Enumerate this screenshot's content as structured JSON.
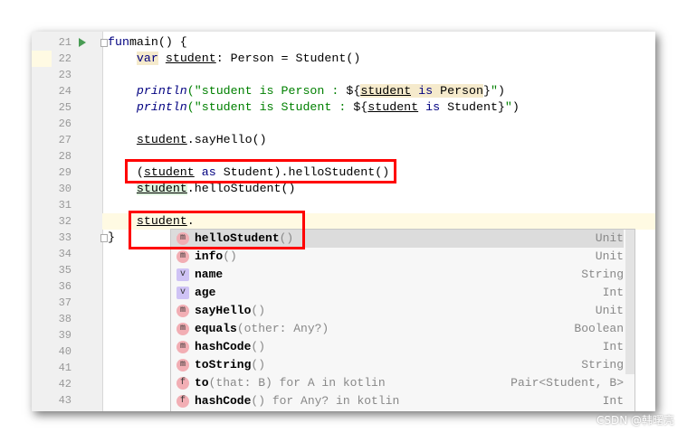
{
  "editor": {
    "lines": [
      {
        "n": "21",
        "run": true,
        "fold": true,
        "seg": [
          [
            "kw",
            "fun"
          ],
          [
            "",
            "main() {"
          ]
        ]
      },
      {
        "n": "22",
        "seg": [
          [
            "",
            "    "
          ],
          [
            "kw hl",
            "var"
          ],
          [
            "",
            " "
          ],
          [
            "ul",
            "student"
          ],
          [
            "",
            ": Person = Student()"
          ]
        ]
      },
      {
        "n": "23",
        "seg": []
      },
      {
        "n": "24",
        "seg": [
          [
            "",
            "    "
          ],
          [
            "fn",
            "println"
          ],
          [
            "str",
            "(\"student is Person : "
          ],
          [
            "",
            "${"
          ],
          [
            "ul hl",
            "student"
          ],
          [
            "hl",
            " "
          ],
          [
            "kw hl",
            "is"
          ],
          [
            "hl",
            " Person"
          ],
          [
            "",
            "}"
          ],
          [
            "str",
            "\""
          ],
          [
            "",
            ")"
          ]
        ]
      },
      {
        "n": "25",
        "seg": [
          [
            "",
            "    "
          ],
          [
            "fn",
            "println"
          ],
          [
            "str",
            "(\"student is Student : "
          ],
          [
            "",
            "${"
          ],
          [
            "ul",
            "student"
          ],
          [
            "",
            " "
          ],
          [
            "kw",
            "is"
          ],
          [
            "",
            " Student}"
          ],
          [
            "str",
            "\""
          ],
          [
            "",
            ")"
          ]
        ]
      },
      {
        "n": "26",
        "seg": []
      },
      {
        "n": "27",
        "seg": [
          [
            "",
            "    "
          ],
          [
            "ul",
            "student"
          ],
          [
            "",
            ".sayHello()"
          ]
        ]
      },
      {
        "n": "28",
        "seg": []
      },
      {
        "n": "29",
        "seg": [
          [
            "",
            "    ("
          ],
          [
            "ul",
            "student"
          ],
          [
            "",
            " "
          ],
          [
            "kw",
            "as"
          ],
          [
            "",
            " Student).helloStudent()"
          ]
        ]
      },
      {
        "n": "30",
        "seg": [
          [
            "",
            "    "
          ],
          [
            "ul gr",
            "student"
          ],
          [
            "",
            ".helloStudent()"
          ]
        ]
      },
      {
        "n": "31",
        "seg": []
      },
      {
        "n": "32",
        "cur": true,
        "seg": [
          [
            "",
            "    "
          ],
          [
            "ul",
            "student"
          ],
          [
            "",
            "."
          ]
        ]
      },
      {
        "n": "33",
        "fold": true,
        "seg": [
          [
            "",
            "}"
          ]
        ]
      },
      {
        "n": "34",
        "seg": []
      },
      {
        "n": "35",
        "seg": []
      },
      {
        "n": "36",
        "seg": []
      },
      {
        "n": "37",
        "seg": []
      },
      {
        "n": "38",
        "seg": []
      },
      {
        "n": "39",
        "seg": []
      },
      {
        "n": "40",
        "seg": []
      },
      {
        "n": "41",
        "seg": []
      },
      {
        "n": "42",
        "seg": []
      },
      {
        "n": "43",
        "seg": []
      }
    ]
  },
  "completion": [
    {
      "icon": "m",
      "name": "helloStudent",
      "tail": "()",
      "type": "Unit",
      "selected": true
    },
    {
      "icon": "m",
      "name": "info",
      "tail": "()",
      "type": "Unit"
    },
    {
      "icon": "v",
      "name": "name",
      "tail": "",
      "type": "String"
    },
    {
      "icon": "v",
      "name": "age",
      "tail": "",
      "type": "Int"
    },
    {
      "icon": "m",
      "name": "sayHello",
      "tail": "()",
      "type": "Unit"
    },
    {
      "icon": "m",
      "name": "equals",
      "tail": "(other: Any?)",
      "type": "Boolean"
    },
    {
      "icon": "m",
      "name": "hashCode",
      "tail": "()",
      "type": "Int"
    },
    {
      "icon": "m",
      "name": "toString",
      "tail": "()",
      "type": "String"
    },
    {
      "icon": "f",
      "name": "to",
      "tail": "(that: B) for A in kotlin",
      "type": "Pair<Student, B>"
    },
    {
      "icon": "f",
      "name": "hashCode",
      "tail": "() for Any? in kotlin",
      "type": "Int"
    }
  ],
  "watermark": "CSDN @韩曙亮"
}
